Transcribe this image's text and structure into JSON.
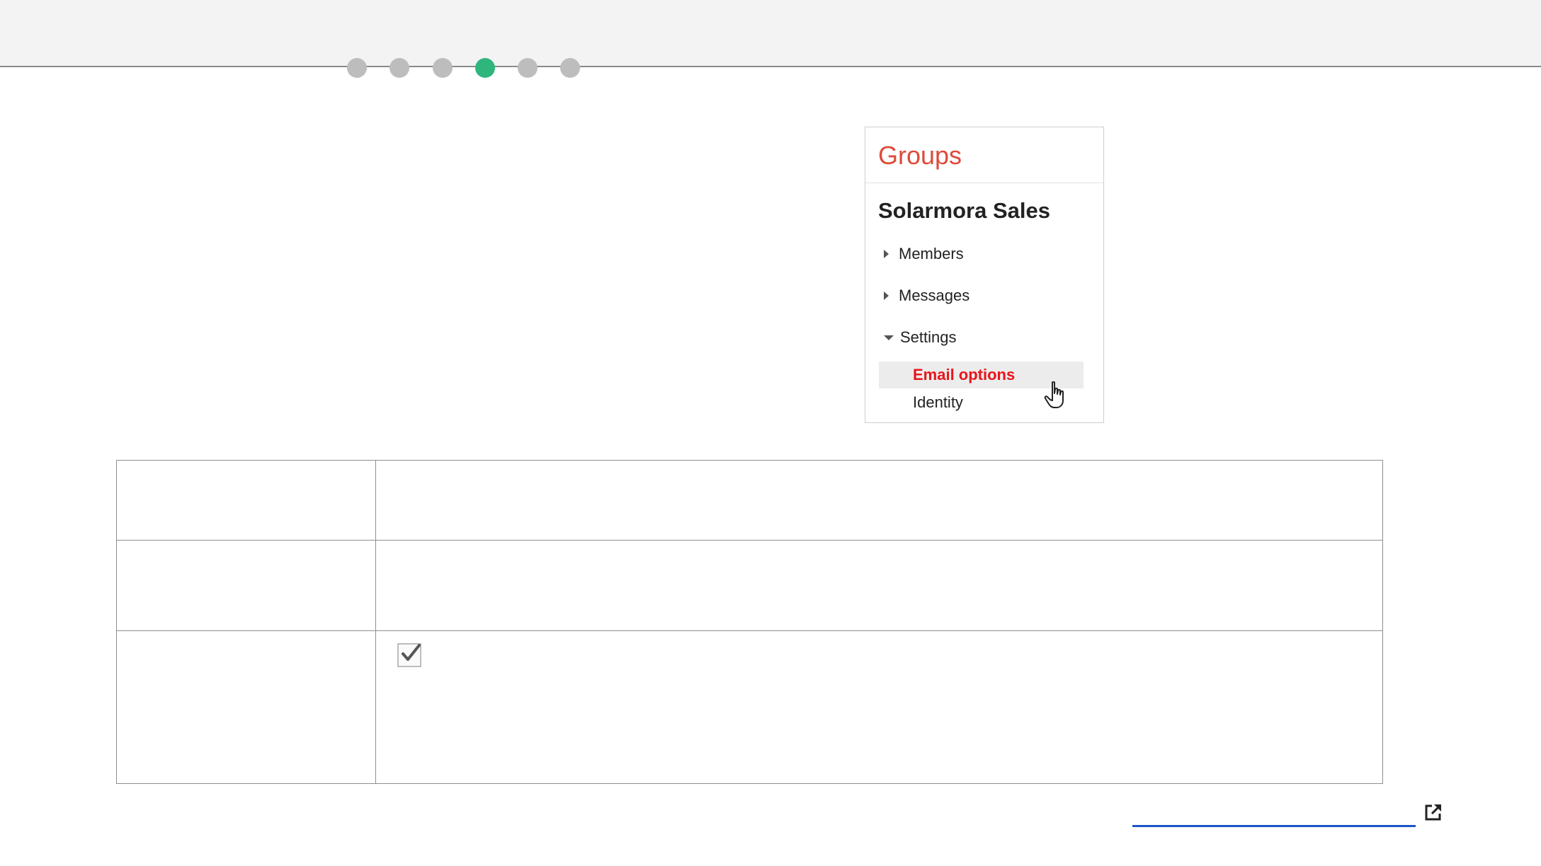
{
  "progress": {
    "total_steps": 6,
    "current_step": 4,
    "active_color": "#2fb67c",
    "inactive_color": "#bdbdbd"
  },
  "groups_panel": {
    "title": "Groups",
    "title_color": "#dd4b39",
    "group_name": "Solarmora Sales",
    "nav": {
      "members": "Members",
      "messages": "Messages",
      "settings": "Settings"
    },
    "settings_sub": {
      "email_options": "Email options",
      "identity": "Identity"
    },
    "selected_color": "#e8151b"
  },
  "settings_table": {
    "checkbox_checked": true
  },
  "link": {
    "color": "#1a56c6",
    "icon": "external-link-icon"
  },
  "cursor": {
    "icon": "hand-pointer-icon"
  }
}
